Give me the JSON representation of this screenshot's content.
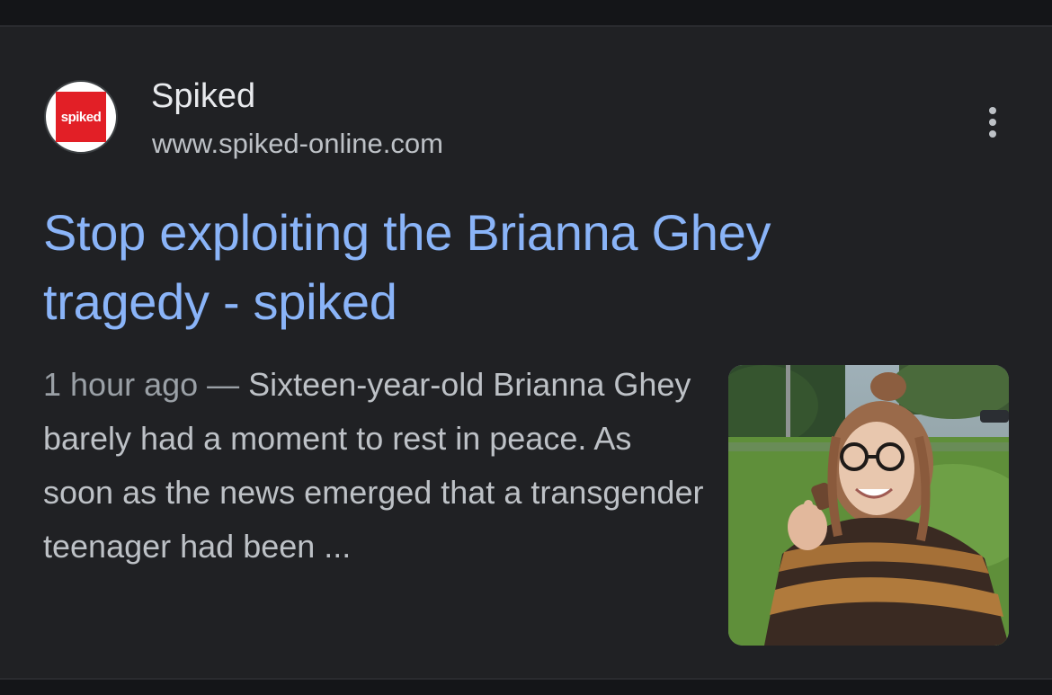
{
  "result": {
    "source": {
      "name": "Spiked",
      "url": "www.spiked-online.com",
      "favicon": {
        "text": "spiked",
        "color": "#e21f26",
        "icon": "spiked-logo-icon"
      }
    },
    "more_icon": "three-dots-vertical-icon",
    "headline": "Stop exploiting the Brianna Ghey tragedy - spiked",
    "age": "1 hour ago",
    "separator": " — ",
    "snippet": "Sixteen-year-old Brianna Ghey barely had a moment to rest in peace. As soon as the news emerged that a transgender teenager had been ...",
    "thumbnail": "photo-thumbnail"
  },
  "colors": {
    "background": "#202124",
    "headline": "#8ab4f8",
    "body_text": "#bdc1c6",
    "title_text": "#e8eaed"
  }
}
